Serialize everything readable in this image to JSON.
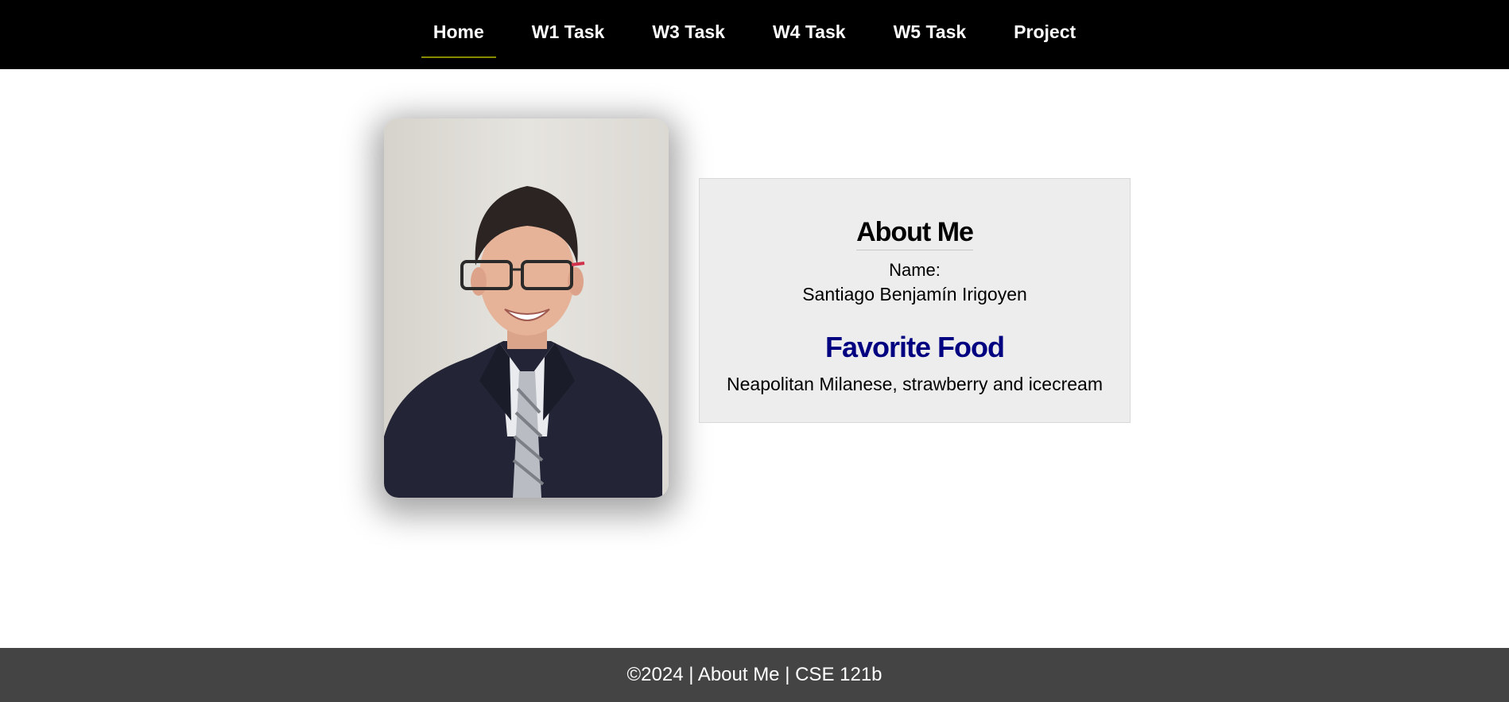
{
  "nav": {
    "items": [
      {
        "label": "Home",
        "active": true
      },
      {
        "label": "W1 Task",
        "active": false
      },
      {
        "label": "W3 Task",
        "active": false
      },
      {
        "label": "W4 Task",
        "active": false
      },
      {
        "label": "W5 Task",
        "active": false
      },
      {
        "label": "Project",
        "active": false
      }
    ]
  },
  "profile": {
    "photo_alt": "portrait-photo"
  },
  "about": {
    "title": "About Me",
    "name_label": "Name:",
    "name_value": "Santiago Benjamín Irigoyen",
    "food_title": "Favorite Food",
    "food_value": "Neapolitan Milanese, strawberry and icecream"
  },
  "footer": {
    "text": "©2024 | About Me | CSE 121b"
  },
  "colors": {
    "nav_bg": "#000000",
    "nav_text": "#ffffff",
    "active_underline": "#8a8a00",
    "box_bg": "#ededed",
    "food_title": "#000080",
    "footer_bg": "#444444"
  }
}
